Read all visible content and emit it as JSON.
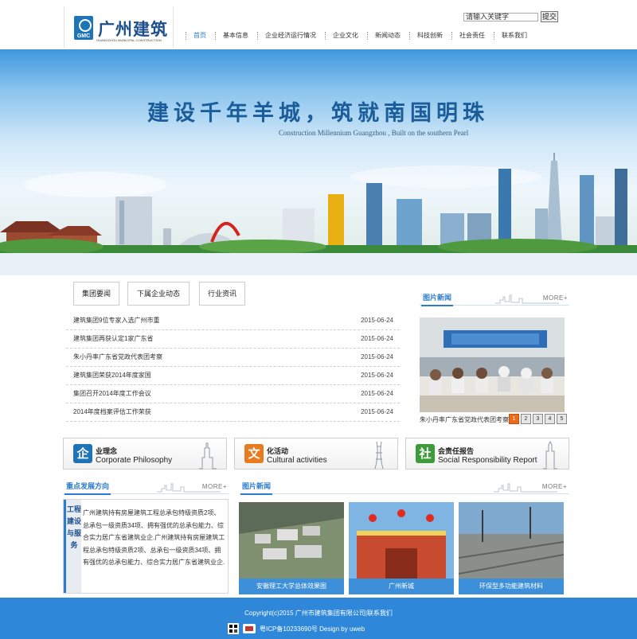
{
  "header": {
    "logo_text": "广州建筑",
    "logo_subtitle": "GUANGZHOU MUNICIPAL CONSTRUCTION",
    "search": {
      "value": "请输入关键字",
      "button": "提交"
    },
    "nav": [
      {
        "label": "首页"
      },
      {
        "label": "基本信息"
      },
      {
        "label": "企业经济运行情况"
      },
      {
        "label": "企业文化"
      },
      {
        "label": "新闻动态"
      },
      {
        "label": "科技创新"
      },
      {
        "label": "社会责任"
      },
      {
        "label": "联系我们"
      }
    ]
  },
  "banner": {
    "slogan": "建设千年羊城，筑就南国明珠",
    "subtitle": "Construction Millennium Guangzhou , Built on the southern Pearl"
  },
  "news_tabs": [
    {
      "label": "集团要闻"
    },
    {
      "label": "下属企业动态"
    },
    {
      "label": "行业资讯"
    }
  ],
  "news_list": [
    {
      "title": "建筑集团9位专家入选广州市重",
      "date": "2015-06-24"
    },
    {
      "title": "建筑集团再获认定1家广东省",
      "date": "2015-06-24"
    },
    {
      "title": "朱小丹率广东省党政代表团考察",
      "date": "2015-06-24"
    },
    {
      "title": "建筑集团荣获2014年度家国",
      "date": "2015-06-24"
    },
    {
      "title": "集团召开2014年度工作会议",
      "date": "2015-06-24"
    },
    {
      "title": "2014年度档案评估工作荣获",
      "date": "2015-06-24"
    }
  ],
  "photo_news": {
    "title": "图片新闻",
    "more": "MORE+",
    "caption": "朱小丹率广东省党政代表团考察",
    "pages": [
      "1",
      "2",
      "3",
      "4",
      "5"
    ],
    "active_page": 1
  },
  "features": [
    {
      "title": "业理念",
      "subtitle": "Corporate Philosophy",
      "icon": "philosophy-icon",
      "color": "#1f73b7",
      "glyph": "企"
    },
    {
      "title": "化活动",
      "subtitle": "Cultural activities",
      "icon": "culture-icon",
      "color": "#e77b22",
      "glyph": "文"
    },
    {
      "title": "会责任报告",
      "subtitle": "Social Responsibility Report",
      "icon": "responsibility-icon",
      "color": "#3f9b3a",
      "glyph": "社"
    }
  ],
  "key_dev": {
    "title": "重点发展方向",
    "more": "MORE+",
    "vertical_label": "工程建设与服务",
    "text": "广州建筑持有房屋建筑工程总承包特级资质2项、总承包一级资质34项、拥有强优的总承包能力、综合实力居广东省建筑业企.广州建筑持有房屋建筑工程总承包特级资质2项、总承包一级资质34项、拥有强优的总承包能力、综合实力居广东省建筑业企."
  },
  "image_news": {
    "title": "图片新闻",
    "more": "MORE+",
    "items": [
      {
        "caption": "安徽理工大学总体效果图"
      },
      {
        "caption": "广州新城"
      },
      {
        "caption": "环保型多功能建筑材料"
      }
    ]
  },
  "footer": {
    "copyright": "Copyright(c)2015 广州市建筑集团有限公司|联系我们",
    "icp": "粤ICP备10233690号 Design by uweb"
  },
  "colors": {
    "brand_blue": "#2b7ccd",
    "footer_blue": "#2e87d8",
    "pager_active": "#ef6a1a"
  }
}
